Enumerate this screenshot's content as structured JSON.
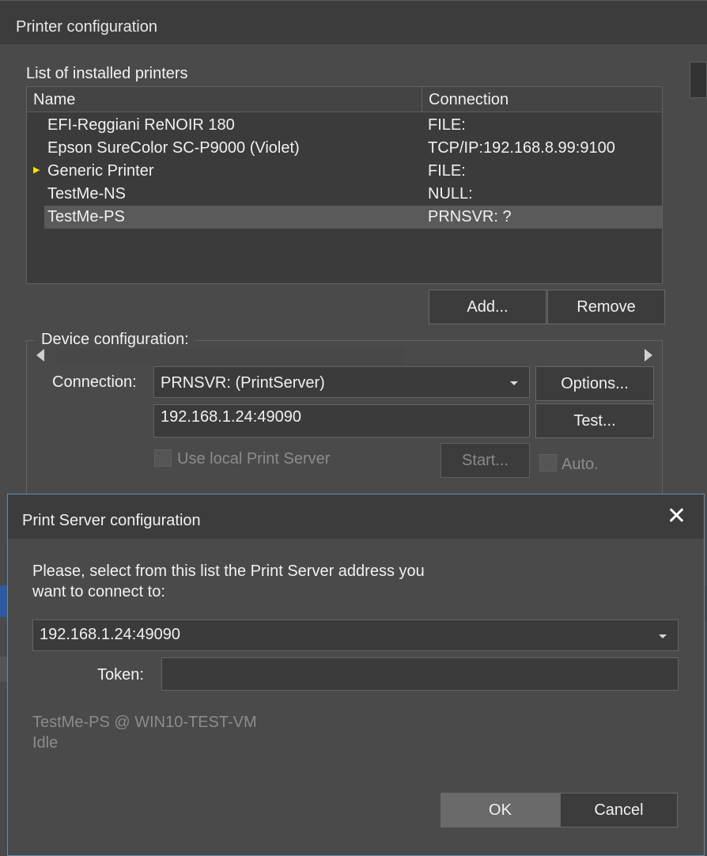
{
  "back_window": {
    "title": "Printer configuration",
    "list_label": "List of installed printers",
    "columns": [
      "Name",
      "Connection"
    ],
    "printers": [
      {
        "name": "EFI-Reggiani ReNOIR 180",
        "connection": "FILE:"
      },
      {
        "name": "Epson SureColor SC-P9000 (Violet)",
        "connection": "TCP/IP:192.168.8.99:9100"
      },
      {
        "name": "Generic Printer",
        "connection": "FILE:",
        "default_marker": "▶"
      },
      {
        "name": "TestMe-NS",
        "connection": "NULL:"
      },
      {
        "name": "TestMe-PS",
        "connection": "PRNSVR: ?",
        "selected": true
      }
    ],
    "add_label": "Add...",
    "remove_label": "Remove",
    "device_group_title": "Device configuration:",
    "connection_label": "Connection:",
    "connection_value": "PRNSVR: (PrintServer)",
    "address_value": "192.168.1.24:49090",
    "options_label": "Options...",
    "test_label": "Test...",
    "use_local_label": "Use local Print Server",
    "start_label": "Start...",
    "auto_label": "Auto."
  },
  "dialog": {
    "title": "Print Server configuration",
    "close_glyph": "✕",
    "prompt_line1": "Please, select from this list the Print Server address you",
    "prompt_line2": "want to connect to:",
    "address_selected": "192.168.1.24:49090",
    "token_label": "Token:",
    "token_value": "",
    "status_line1": "TestMe-PS @ WIN10-TEST-VM",
    "status_line2": "Idle",
    "ok_label": "OK",
    "cancel_label": "Cancel"
  }
}
